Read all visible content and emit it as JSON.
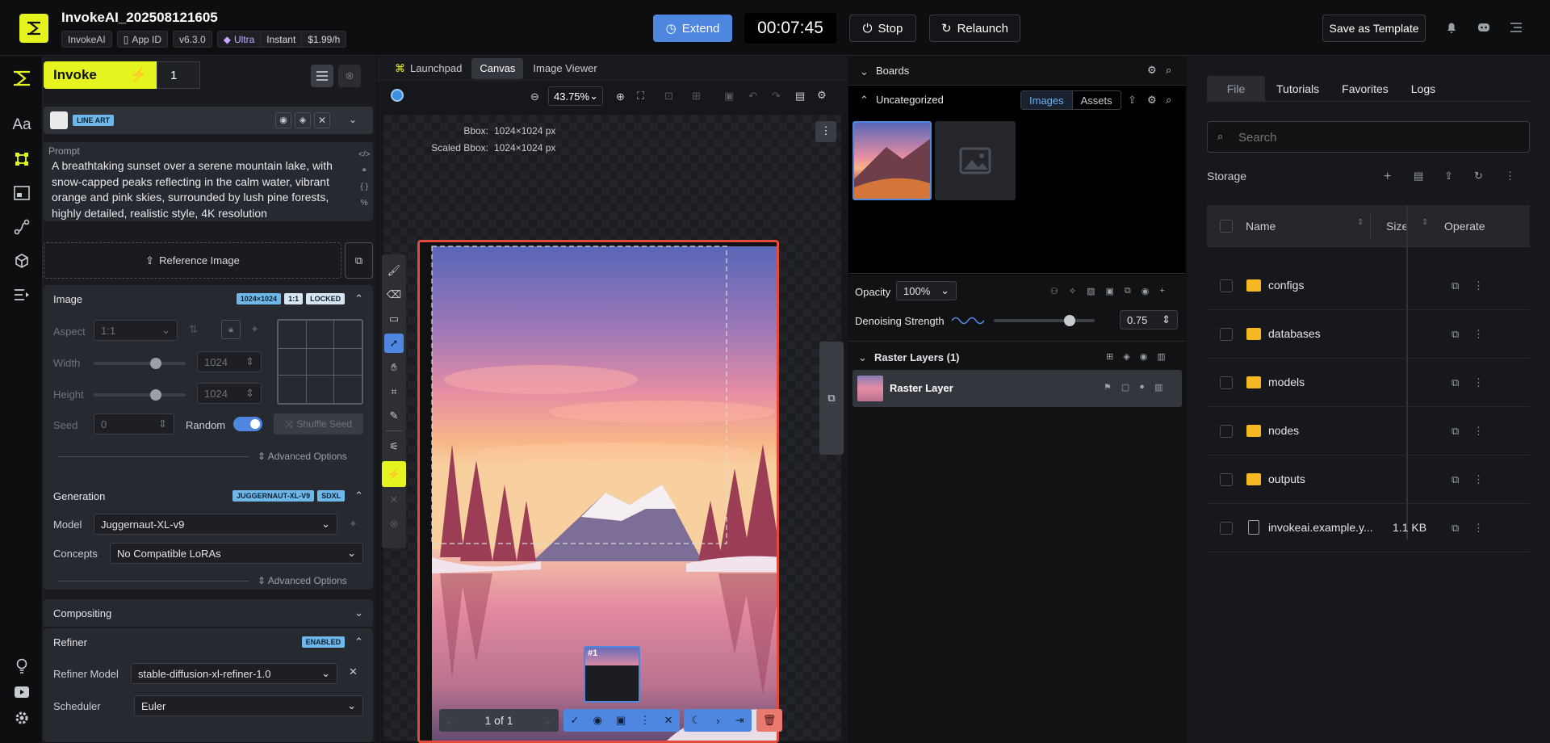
{
  "topbar": {
    "app_title": "InvokeAI_202508121605",
    "chip_name": "InvokeAI",
    "chip_appid": "App ID",
    "chip_version": "v6.3.0",
    "tier_ultra": "Ultra",
    "tier_instant": "Instant",
    "tier_price": "$1.99/h",
    "extend_label": "Extend",
    "timer": "00:07:45",
    "stop_label": "Stop",
    "relaunch_label": "Relaunch",
    "save_template_label": "Save as Template"
  },
  "left_panel": {
    "invoke_label": "Invoke",
    "queue_count": "1",
    "lineart_badge": "LINE ART",
    "prompt_label": "Prompt",
    "prompt_text": "A breathtaking sunset over a serene mountain lake, with snow-capped peaks reflecting in the calm water, vibrant orange and pink skies, surrounded by lush pine forests, highly detailed, realistic style, 4K resolution",
    "reference_image_label": "Reference Image",
    "image_section": {
      "title": "Image",
      "tag_size": "1024×1024",
      "tag_ratio": "1:1",
      "tag_locked": "LOCKED",
      "aspect_label": "Aspect",
      "aspect_value": "1:1",
      "width_label": "Width",
      "width_value": "1024",
      "height_label": "Height",
      "height_value": "1024",
      "seed_label": "Seed",
      "seed_value": "0",
      "random_label": "Random",
      "shuffle_seed_label": "Shuffle Seed",
      "advanced_label": "Advanced Options"
    },
    "generation_section": {
      "title": "Generation",
      "tag_model": "JUGGERNAUT-XL-V9",
      "tag_base": "SDXL",
      "model_label": "Model",
      "model_value": "Juggernaut-XL-v9",
      "concepts_label": "Concepts",
      "concepts_value": "No Compatible LoRAs",
      "advanced_label": "Advanced Options"
    },
    "compositing_title": "Compositing",
    "refiner_section": {
      "title": "Refiner",
      "tag_enabled": "ENABLED",
      "refiner_model_label": "Refiner Model",
      "refiner_model_value": "stable-diffusion-xl-refiner-1.0",
      "scheduler_label": "Scheduler",
      "scheduler_value": "Euler"
    }
  },
  "center": {
    "tabs": [
      "Launchpad",
      "Canvas",
      "Image Viewer"
    ],
    "zoom": "43.75%",
    "bbox_label": "Bbox:",
    "bbox_value": "1024×1024 px",
    "scaled_bbox_label": "Scaled Bbox:",
    "scaled_bbox_value": "1024×1024 px",
    "staging_counter": "1 of 1",
    "thumb_label": "#1"
  },
  "boards": {
    "title": "Boards",
    "uncategorized_label": "Uncategorized",
    "images_tab": "Images",
    "assets_tab": "Assets",
    "opacity_label": "Opacity",
    "opacity_value": "100%",
    "denoise_label": "Denoising Strength",
    "denoise_value": "0.75",
    "denoise_fraction": 0.75,
    "raster_layers_title": "Raster Layers (1)",
    "raster_layer_name": "Raster Layer"
  },
  "file_panel": {
    "tabs": [
      "File",
      "Tutorials",
      "Favorites",
      "Logs"
    ],
    "search_placeholder": "Search",
    "storage_label": "Storage",
    "col_name": "Name",
    "col_size": "Size",
    "col_operate": "Operate",
    "rows": [
      {
        "name": "configs",
        "size": "",
        "type": "folder"
      },
      {
        "name": "databases",
        "size": "",
        "type": "folder"
      },
      {
        "name": "models",
        "size": "",
        "type": "folder"
      },
      {
        "name": "nodes",
        "size": "",
        "type": "folder"
      },
      {
        "name": "outputs",
        "size": "",
        "type": "folder"
      },
      {
        "name": "invokeai.example.y...",
        "size": "1.1 KB",
        "type": "file"
      }
    ]
  },
  "colors": {
    "accent": "#e5f41e",
    "blue": "#5a8de6",
    "selection": "#e24b3b"
  }
}
